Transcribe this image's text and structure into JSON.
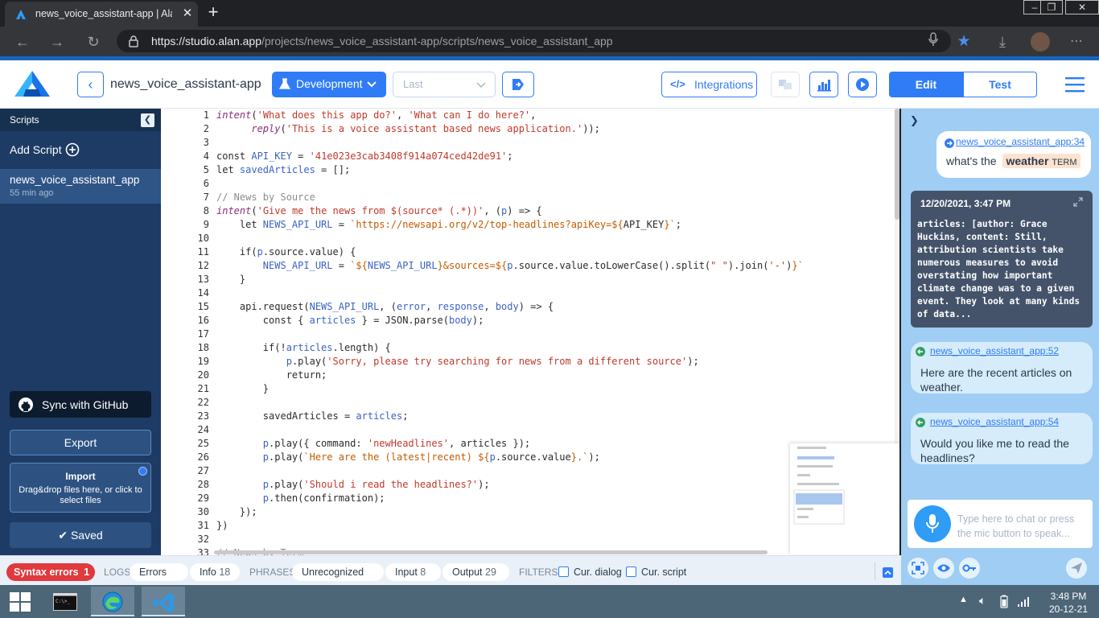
{
  "browser": {
    "tab_title": "news_voice_assistant-app | Alan Studio",
    "url_host": "https://studio.alan.app",
    "url_path": "/projects/news_voice_assistant-app/scripts/news_voice_assistant_app"
  },
  "header": {
    "project_name": "news_voice_assistant-app",
    "environment": "Development",
    "version_placeholder": "Last",
    "integrations_label": "Integrations",
    "edit_label": "Edit",
    "test_label": "Test",
    "accent_color": "#2f7cf6"
  },
  "sidebar": {
    "title": "Scripts",
    "add_script": "Add Script",
    "scripts": [
      {
        "name": "news_voice_assistant_app",
        "time": "55 min ago"
      }
    ],
    "github_label": "Sync with GitHub",
    "export_label": "Export",
    "import_title": "Import",
    "import_hint": "Drag&drop files here, or click to select files",
    "saved_label": "Saved"
  },
  "editor": {
    "lines": [
      {
        "n": "1",
        "html": "<span class='kw'>intent</span>(<span class='str'>'What does this app do?'</span>, <span class='str'>'What can I do here?'</span>,"
      },
      {
        "n": "2",
        "html": "      <span class='kw'>reply</span>(<span class='str'>'This is a voice assistant based news application.'</span>));"
      },
      {
        "n": "3",
        "html": ""
      },
      {
        "n": "4",
        "html": "const <span class='var'>API_KEY</span> = <span class='str'>'41e023e3cab3408f914a074ced42de91'</span>;"
      },
      {
        "n": "5",
        "html": "let <span class='var'>savedArticles</span> = [];"
      },
      {
        "n": "6",
        "html": ""
      },
      {
        "n": "7",
        "html": "<span class='cmt'>// News by Source</span>"
      },
      {
        "n": "8",
        "html": "<span class='kw'>intent</span>(<span class='str'>'Give me the news from $(source* (.*))'</span>, (<span class='var'>p</span>) =&gt; {"
      },
      {
        "n": "9",
        "html": "    let <span class='var'>NEWS_API_URL</span> = <span class='tpl'>`https://newsapi.org/v2/top-headlines?apiKey=${</span>API_KEY<span class='tpl'>}`</span>;"
      },
      {
        "n": "10",
        "html": ""
      },
      {
        "n": "11",
        "html": "    if(<span class='var'>p</span>.source.value) {"
      },
      {
        "n": "12",
        "html": "        <span class='var'>NEWS_API_URL</span> = <span class='tpl'>`${</span><span class='var'>NEWS_API_URL</span><span class='tpl'>}&amp;sources=${</span><span class='var'>p</span>.source.value.toLowerCase().split(<span class='str'>\" \"</span>).join(<span class='str'>'-'</span>)<span class='tpl'>}`</span>"
      },
      {
        "n": "13",
        "html": "    }"
      },
      {
        "n": "14",
        "html": ""
      },
      {
        "n": "15",
        "html": "    api.request(<span class='var'>NEWS_API_URL</span>, (<span class='var'>error</span>, <span class='var'>response</span>, <span class='var'>body</span>) =&gt; {"
      },
      {
        "n": "16",
        "html": "        const { <span class='var'>articles</span> } = JSON.parse(<span class='var'>body</span>);"
      },
      {
        "n": "17",
        "html": ""
      },
      {
        "n": "18",
        "html": "        if(!<span class='var'>articles</span>.length) {"
      },
      {
        "n": "19",
        "html": "            <span class='var'>p</span>.play(<span class='str'>'Sorry, please try searching for news from a different source'</span>);"
      },
      {
        "n": "20",
        "html": "            return;"
      },
      {
        "n": "21",
        "html": "        }"
      },
      {
        "n": "22",
        "html": ""
      },
      {
        "n": "23",
        "html": "        savedArticles = <span class='var'>articles</span>;"
      },
      {
        "n": "24",
        "html": ""
      },
      {
        "n": "25",
        "html": "        <span class='var'>p</span>.play({ command: <span class='str'>'newHeadlines'</span>, articles });"
      },
      {
        "n": "26",
        "html": "        <span class='var'>p</span>.play(<span class='tpl'>`Here are the (latest|recent) ${</span><span class='var'>p</span>.source.value<span class='tpl'>}.`</span>);"
      },
      {
        "n": "27",
        "html": ""
      },
      {
        "n": "28",
        "html": "        <span class='var'>p</span>.play(<span class='str'>'Should i read the headlines?'</span>);"
      },
      {
        "n": "29",
        "html": "        <span class='var'>p</span>.then(confirmation);"
      },
      {
        "n": "30",
        "html": "    });"
      },
      {
        "n": "31",
        "html": "})"
      },
      {
        "n": "32",
        "html": ""
      },
      {
        "n": "33",
        "html": "<span class='cmt'>// News by Term</span>"
      }
    ]
  },
  "chat": {
    "user_link": "news_voice_assistant_app:34",
    "user_text": "what's the",
    "user_slot_value": "weather",
    "user_slot_name": "TERM",
    "log_datetime": "12/20/2021, 3:47 PM",
    "log_body": "articles: [author: Grace Huckins, content: Still, attribution scientists take numerous measures to avoid overstating how important climate change was to a given event. They look at many kinds of data...",
    "bot_msgs": [
      {
        "link": "news_voice_assistant_app:52",
        "text": "Here are the recent articles on weather."
      },
      {
        "link": "news_voice_assistant_app:54",
        "text": "Would you like me to read the headlines?"
      }
    ],
    "input_placeholder": "Type here to chat or press the mic button to speak..."
  },
  "logbar": {
    "syntax_errors_label": "Syntax errors",
    "syntax_errors_count": "1",
    "logs_label": "LOGS",
    "errors_label": "Errors",
    "info_label": "Info",
    "info_count": "18",
    "phrases_label": "PHRASES",
    "unrecognized_label": "Unrecognized",
    "input_label": "Input",
    "input_count": "8",
    "output_label": "Output",
    "output_count": "29",
    "filters_label": "FILTERS",
    "cur_dialog_label": "Cur. dialog",
    "cur_script_label": "Cur. script"
  },
  "taskbar": {
    "time": "3:48 PM",
    "date": "20-12-21"
  }
}
